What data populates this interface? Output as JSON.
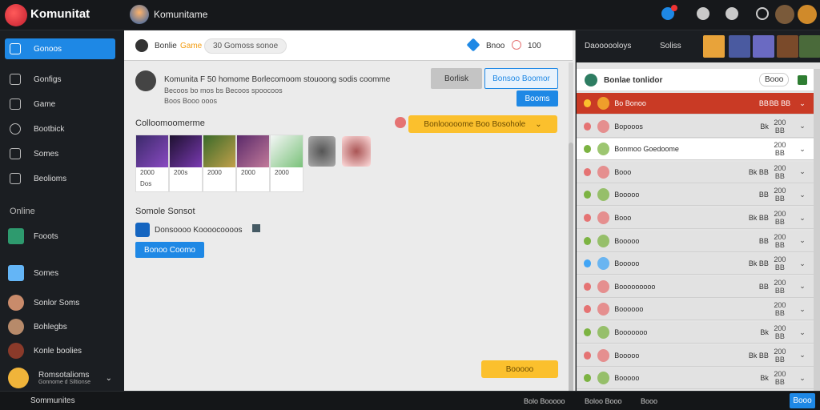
{
  "app": {
    "logo_text": "Komunitat",
    "title": "Komunitame"
  },
  "sidebar": {
    "items": [
      {
        "label": "Gonoos",
        "active": true
      },
      {
        "label": "Gonfigs"
      },
      {
        "label": "Game"
      },
      {
        "label": "Bootbick"
      },
      {
        "label": "Somes"
      },
      {
        "label": "Beolioms"
      }
    ],
    "online_header": "Online",
    "online": [
      {
        "label": "Fooots"
      },
      {
        "label": "Somes"
      },
      {
        "label": "Sonlor Soms"
      },
      {
        "label": "Bohlegbs"
      },
      {
        "label": "Konle boolies"
      },
      {
        "label": "Romsotalioms",
        "sub": "Gonnome d Siltionse"
      }
    ],
    "footer": "Sommunites"
  },
  "topbar": {
    "icons": [
      "bell-icon",
      "user-icon",
      "settings-icon",
      "search-icon"
    ]
  },
  "main": {
    "header": {
      "title": "Bonlie",
      "tag": "Game",
      "chip": "30 Gomoss sonoe",
      "link1": "Bnoo",
      "link2": "100"
    },
    "post": {
      "title": "Komunita F 50 homome Borlecomoom stouoong sodis coomme",
      "line2": "Becoos bo mos bs  Becoos spoocoos",
      "line3": "Boos Booo ooos",
      "btn_secondary": "Borlisk",
      "btn_outline": "Bonsoo Boomor",
      "btn_primary": "Booms"
    },
    "collection": {
      "title": "Colloomoomerme",
      "promo": "Bonlooooome Boo Bosohole",
      "cards": [
        {
          "label": "2000",
          "sub": "Dos",
          "color": "#6a3d9a"
        },
        {
          "label": "200s",
          "color": "#3b1f5a"
        },
        {
          "label": "2000",
          "color": "#4e7a3a"
        },
        {
          "label": "2000",
          "color": "#7a3d8a"
        },
        {
          "label": "2000",
          "color": "#e9eef0"
        }
      ]
    },
    "section": {
      "title": "Somole Sonsot",
      "item": "Donsoooo Koooocoooos",
      "btn": "Bonoo Coomo"
    },
    "bottom_btn": "Booooo"
  },
  "right": {
    "top_title": "Daoooooloys",
    "top_sub": "Soliss",
    "panel_title": "Bonlae tonlidor",
    "panel_chip": "Booo",
    "rows": [
      {
        "name": "Bo Bonoo",
        "val": "BB",
        "v2": "BB BB",
        "color": "#fbc02d",
        "style": "hl"
      },
      {
        "name": "Bopooos",
        "val": "Bk",
        "v2": "200 BB",
        "color": "#e57373"
      },
      {
        "name": "Bonmoo Goedoome",
        "val": "",
        "v2": "200 BB",
        "color": "#7cb342",
        "style": "sel"
      },
      {
        "name": "Booo",
        "val": "Bk BB",
        "v2": "200 BB",
        "color": "#e57373"
      },
      {
        "name": "Booooo",
        "val": "BB",
        "v2": "200 BB",
        "color": "#7cb342"
      },
      {
        "name": "Booo",
        "val": "Bk BB",
        "v2": "200 BB",
        "color": "#e57373"
      },
      {
        "name": "Booooo",
        "val": "BB",
        "v2": "200 BB",
        "color": "#7cb342"
      },
      {
        "name": "Booooo",
        "val": "Bk BB",
        "v2": "200 BB",
        "color": "#42a5f5"
      },
      {
        "name": "Booooooooo",
        "val": "BB",
        "v2": "200 BB",
        "color": "#e57373"
      },
      {
        "name": "Boooooo",
        "val": "",
        "v2": "200 BB",
        "color": "#e57373"
      },
      {
        "name": "Booooooo",
        "val": "Bk",
        "v2": "200 BB",
        "color": "#7cb342"
      },
      {
        "name": "Booooo",
        "val": "Bk BB",
        "v2": "200 BB",
        "color": "#e57373"
      },
      {
        "name": "Booooo",
        "val": "Bk",
        "v2": "200 BB",
        "color": "#7cb342"
      }
    ]
  },
  "footer": {
    "left": "Bolo Booooo",
    "mid": "Boloo Booo",
    "right": "Booo",
    "btn": "Booo"
  }
}
